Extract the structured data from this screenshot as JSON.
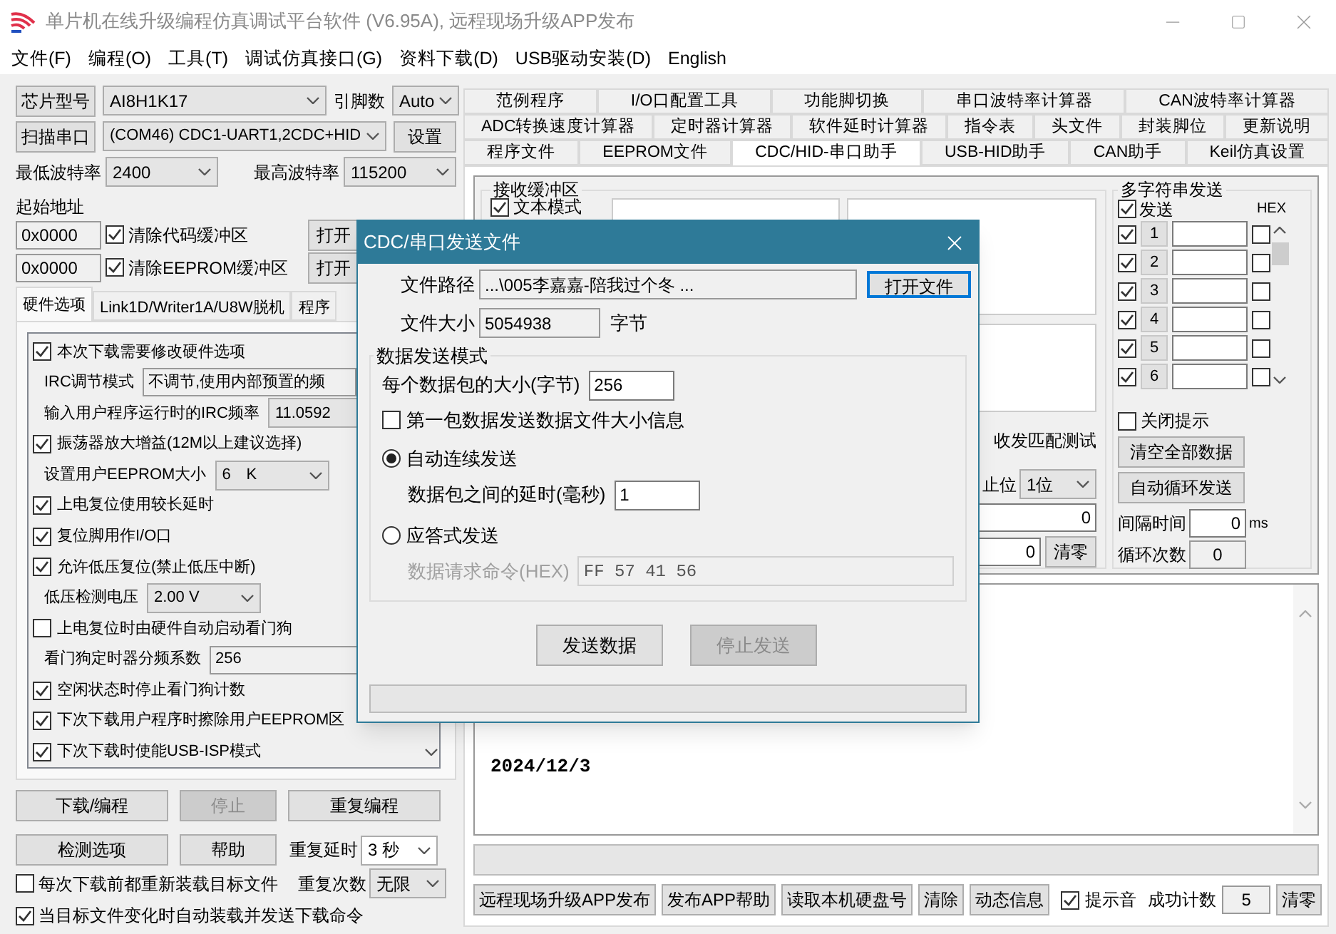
{
  "window": {
    "title": "单片机在线升级编程仿真调试平台软件 (V6.95A), 远程现场升级APP发布"
  },
  "menu": [
    "文件(F)",
    "编程(O)",
    "工具(T)",
    "调试仿真接口(G)",
    "资料下载(D)",
    "USB驱动安装(D)",
    "English"
  ],
  "left": {
    "chip_button": "芯片型号",
    "chip": "AI8H1K17",
    "pins_label": "引脚数",
    "pins": "Auto",
    "scan_button": "扫描串口",
    "port": "(COM46) CDC1-UART1,2CDC+HID",
    "settings_button": "设置",
    "min_baud_label": "最低波特率",
    "min_baud": "2400",
    "max_baud_label": "最高波特率",
    "max_baud": "115200",
    "start_address_label": "起始地址",
    "address_rows": [
      {
        "address": "0x0000",
        "label": "清除代码缓冲区",
        "checked": true,
        "button": "打开"
      },
      {
        "address": "0x0000",
        "label": "清除EEPROM缓冲区",
        "checked": true,
        "button": "打开"
      }
    ],
    "tabs": [
      {
        "label": "硬件选项",
        "selected": true
      },
      {
        "label": "Link1D/Writer1A/U8W脱机",
        "selected": false
      },
      {
        "label": "程序",
        "selected": false
      }
    ],
    "options": [
      {
        "kind": "check",
        "label": "本次下载需要修改硬件选项",
        "checked": true
      },
      {
        "kind": "field",
        "label": "IRC调节模式",
        "value": "不调节,使用内部预置的频"
      },
      {
        "kind": "combo",
        "label": "输入用户程序运行时的IRC频率",
        "value": "11.0592"
      },
      {
        "kind": "check",
        "label": "振荡器放大增益(12M以上建议选择)",
        "checked": true
      },
      {
        "kind": "combo",
        "label": "设置用户EEPROM大小",
        "value": "6　K"
      },
      {
        "kind": "check",
        "label": "上电复位使用较长延时",
        "checked": true
      },
      {
        "kind": "check",
        "label": "复位脚用作I/O口",
        "checked": true
      },
      {
        "kind": "check",
        "label": "允许低压复位(禁止低压中断)",
        "checked": true
      },
      {
        "kind": "combo",
        "label": "低压检测电压",
        "value": "2.00 V"
      },
      {
        "kind": "check",
        "label": "上电复位时由硬件自动启动看门狗",
        "checked": false
      },
      {
        "kind": "field",
        "label": "看门狗定时器分频系数",
        "value": "256"
      },
      {
        "kind": "check",
        "label": "空闲状态时停止看门狗计数",
        "checked": true
      },
      {
        "kind": "check",
        "label": "下次下载用户程序时擦除用户EEPROM区",
        "checked": true
      },
      {
        "kind": "check",
        "label": "下次下载时使能USB-ISP模式",
        "checked": true
      }
    ],
    "action_buttons": [
      {
        "label": "下载/编程",
        "disabled": false
      },
      {
        "label": "停止",
        "disabled": true
      },
      {
        "label": "重复编程",
        "disabled": false
      }
    ],
    "tool_buttons": [
      {
        "label": "检测选项",
        "disabled": false
      },
      {
        "label": "帮助",
        "disabled": false
      }
    ],
    "repeat_delay_label": "重复延时",
    "repeat_delay": "3 秒",
    "repeat_count_label": "重复次数",
    "repeat_count": "无限",
    "checks": [
      {
        "label": "每次下载前都重新装载目标文件",
        "checked": false
      },
      {
        "label": "当目标文件变化时自动装载并发送下载命令",
        "checked": true
      }
    ]
  },
  "right": {
    "tab_rows": [
      [
        {
          "label": "范例程序",
          "selected": false
        },
        {
          "label": "I/O口配置工具",
          "selected": false
        },
        {
          "label": "功能脚切换",
          "selected": false
        },
        {
          "label": "串口波特率计算器",
          "selected": false
        },
        {
          "label": "CAN波特率计算器",
          "selected": false
        }
      ],
      [
        {
          "label": "ADC转换速度计算器",
          "selected": false
        },
        {
          "label": "定时器计算器",
          "selected": false
        },
        {
          "label": "软件延时计算器",
          "selected": false
        },
        {
          "label": "指令表",
          "selected": false
        },
        {
          "label": "头文件",
          "selected": false
        },
        {
          "label": "封装脚位",
          "selected": false
        },
        {
          "label": "更新说明",
          "selected": false
        }
      ],
      [
        {
          "label": "程序文件",
          "selected": false
        },
        {
          "label": "EEPROM文件",
          "selected": false
        },
        {
          "label": "CDC/HID-串口助手",
          "selected": true
        },
        {
          "label": "USB-HID助手",
          "selected": false
        },
        {
          "label": "CAN助手",
          "selected": false
        },
        {
          "label": "Keil仿真设置",
          "selected": false
        }
      ]
    ],
    "receive": {
      "title": "接收缓冲区",
      "text_mode": {
        "label": "文本模式",
        "checked": true
      },
      "match_test": "收发匹配测试",
      "stop_bits_label": "止位",
      "stop_bits": "1位",
      "count_fields": [
        "0",
        "0"
      ],
      "clear_button": "清零"
    },
    "multi_send": {
      "title": "多字符串发送",
      "send_all": {
        "label": "发送",
        "checked": true
      },
      "hex_label": "HEX",
      "rows": [
        {
          "checked": true,
          "number": "1",
          "hex": false
        },
        {
          "checked": true,
          "number": "2",
          "hex": false
        },
        {
          "checked": true,
          "number": "3",
          "hex": false
        },
        {
          "checked": true,
          "number": "4",
          "hex": false
        },
        {
          "checked": true,
          "number": "5",
          "hex": false
        },
        {
          "checked": true,
          "number": "6",
          "hex": false
        }
      ],
      "close_tips": {
        "label": "关闭提示",
        "checked": false
      },
      "clear_all_button": "清空全部数据",
      "auto_loop_button": "自动循环发送",
      "interval_label": "间隔时间",
      "interval": "0",
      "interval_unit": "ms",
      "loop_label": "循环次数",
      "loop_count": "0"
    },
    "output": {
      "lines": [
        "2024/12/3"
      ]
    },
    "progress": {
      "level": 0
    },
    "bottom_bar": {
      "buttons": [
        "远程现场升级APP发布",
        "发布APP帮助",
        "读取本机硬盘号",
        "清除",
        "动态信息"
      ],
      "beep": {
        "label": "提示音",
        "checked": true
      },
      "success_label": "成功计数",
      "success_count": "5",
      "clear_button": "清零"
    }
  },
  "dialog": {
    "title": "CDC/串口发送文件",
    "path_label": "文件路径",
    "path": "...\\005李嘉嘉-陪我过个冬 ...",
    "open_button": "打开文件",
    "size_label": "文件大小",
    "size": "5054938",
    "size_unit": "字节",
    "mode_group": "数据发送模式",
    "packet_size_label": "每个数据包的大小(字节)",
    "packet_size": "256",
    "first_packet": {
      "label": "第一包数据发送数据文件大小信息",
      "checked": false
    },
    "modes": [
      {
        "label": "自动连续发送",
        "selected": true,
        "field_label": "数据包之间的延时(毫秒)",
        "value": "1",
        "disabled": false
      },
      {
        "label": "应答式发送",
        "selected": false,
        "field_label": "数据请求命令(HEX)",
        "value": "FF 57 41 56",
        "disabled": true
      }
    ],
    "send_button": {
      "label": "发送数据",
      "disabled": false
    },
    "stop_button": {
      "label": "停止发送",
      "disabled": true
    },
    "progress": {
      "level": 0
    }
  }
}
